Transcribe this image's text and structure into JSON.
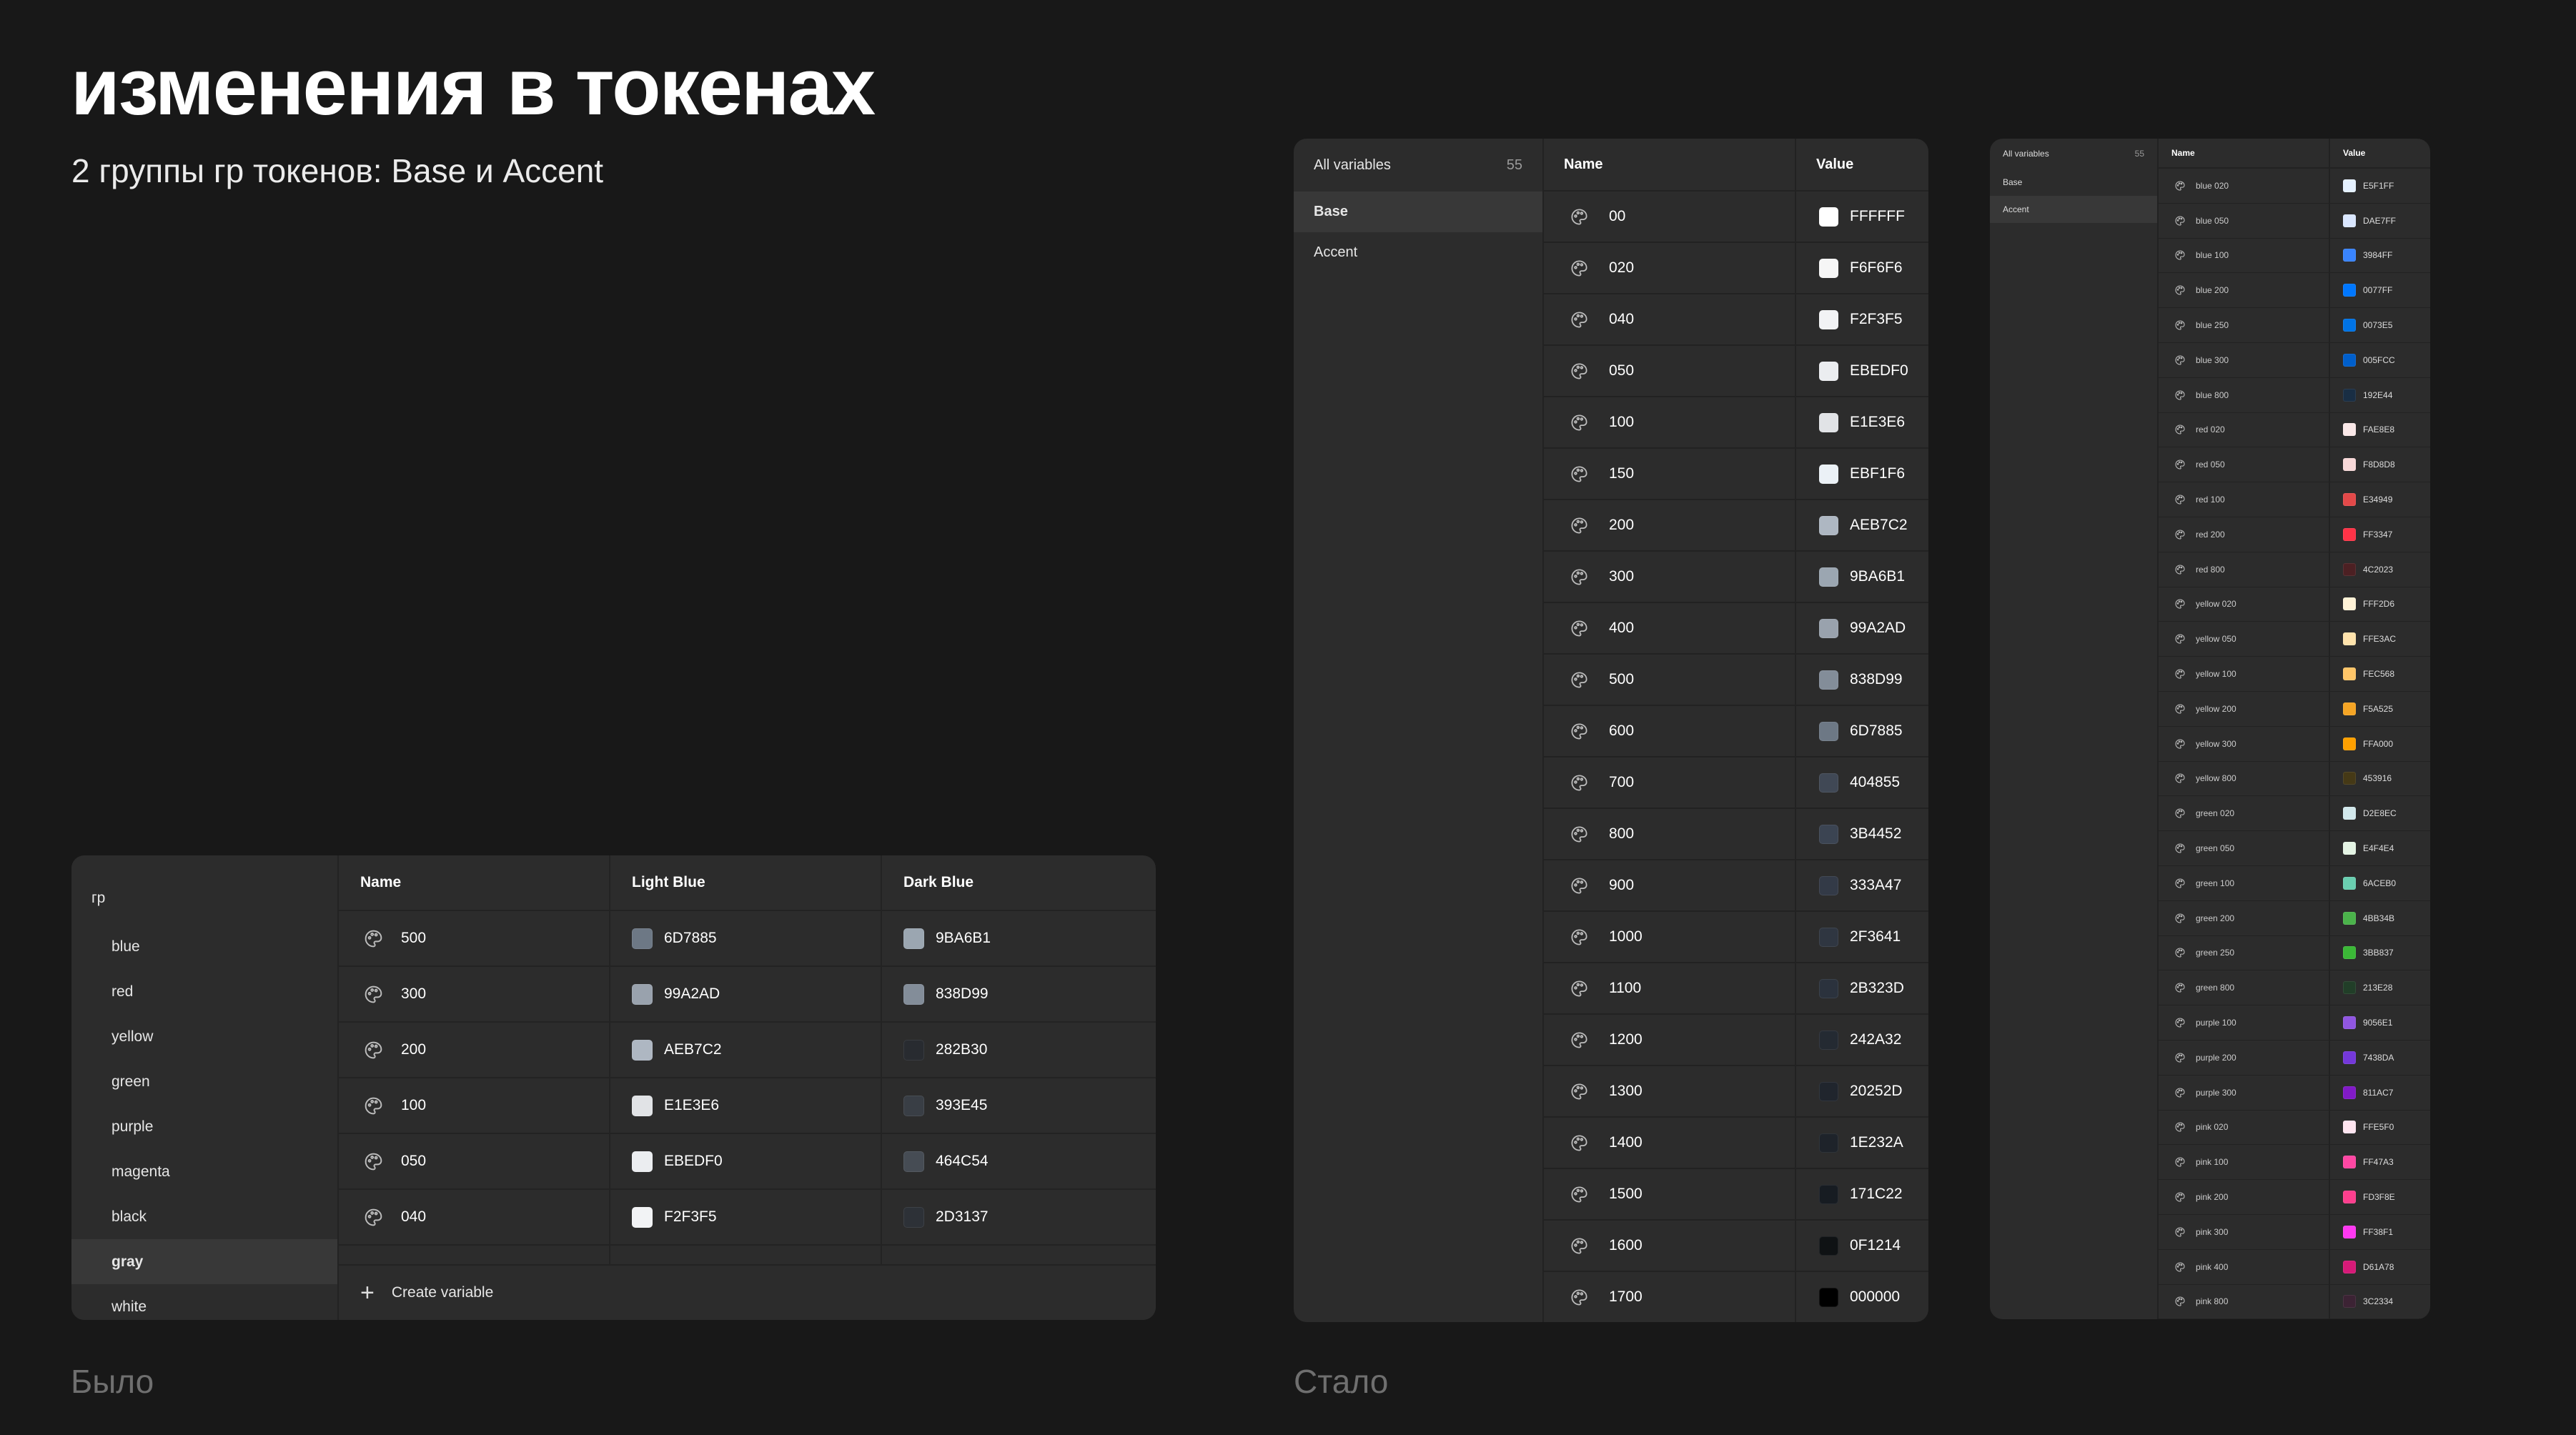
{
  "slide": {
    "title": "изменения в токенах",
    "subtitle": "2 группы гр токенов: Base и Accent",
    "before_caption": "Было",
    "after_caption": "Стало"
  },
  "old_panel": {
    "group": "гр",
    "groups": [
      {
        "label": "blue",
        "active": false
      },
      {
        "label": "red",
        "active": false
      },
      {
        "label": "yellow",
        "active": false
      },
      {
        "label": "green",
        "active": false
      },
      {
        "label": "purple",
        "active": false
      },
      {
        "label": "magenta",
        "active": false
      },
      {
        "label": "black",
        "active": false
      },
      {
        "label": "gray",
        "active": true
      },
      {
        "label": "white",
        "active": false
      }
    ],
    "columns": {
      "name": "Name",
      "light": "Light Blue",
      "dark": "Dark Blue"
    },
    "rows": [
      {
        "name": "500",
        "light": "6D7885",
        "light_color": "#6D7885",
        "dark": "9BA6B1",
        "dark_color": "#9BA6B1"
      },
      {
        "name": "300",
        "light": "99A2AD",
        "light_color": "#99A2AD",
        "dark": "838D99",
        "dark_color": "#838D99"
      },
      {
        "name": "200",
        "light": "AEB7C2",
        "light_color": "#AEB7C2",
        "dark": "282B30",
        "dark_color": "#282B30"
      },
      {
        "name": "100",
        "light": "E1E3E6",
        "light_color": "#E1E3E6",
        "dark": "393E45",
        "dark_color": "#393E45"
      },
      {
        "name": "050",
        "light": "EBEDF0",
        "light_color": "#EBEDF0",
        "dark": "464C54",
        "dark_color": "#464C54"
      },
      {
        "name": "040",
        "light": "F2F3F5",
        "light_color": "#F2F3F5",
        "dark": "2D3137",
        "dark_color": "#2D3137"
      }
    ],
    "create_label": "Create variable"
  },
  "new_panel_base": {
    "sidebar_header": "All variables",
    "count": "55",
    "groups": [
      {
        "label": "Base",
        "active": true
      },
      {
        "label": "Accent",
        "active": false
      }
    ],
    "columns": {
      "name": "Name",
      "value": "Value"
    },
    "rows": [
      {
        "name": "00",
        "value": "FFFFFF",
        "color": "#FFFFFF"
      },
      {
        "name": "020",
        "value": "F6F6F6",
        "color": "#F6F6F6"
      },
      {
        "name": "040",
        "value": "F2F3F5",
        "color": "#F2F3F5"
      },
      {
        "name": "050",
        "value": "EBEDF0",
        "color": "#EBEDF0"
      },
      {
        "name": "100",
        "value": "E1E3E6",
        "color": "#E1E3E6"
      },
      {
        "name": "150",
        "value": "EBF1F6",
        "color": "#EBF1F6"
      },
      {
        "name": "200",
        "value": "AEB7C2",
        "color": "#AEB7C2"
      },
      {
        "name": "300",
        "value": "9BA6B1",
        "color": "#9BA6B1"
      },
      {
        "name": "400",
        "value": "99A2AD",
        "color": "#99A2AD"
      },
      {
        "name": "500",
        "value": "838D99",
        "color": "#838D99"
      },
      {
        "name": "600",
        "value": "6D7885",
        "color": "#6D7885"
      },
      {
        "name": "700",
        "value": "404855",
        "color": "#404855"
      },
      {
        "name": "800",
        "value": "3B4452",
        "color": "#3B4452"
      },
      {
        "name": "900",
        "value": "333A47",
        "color": "#333A47"
      },
      {
        "name": "1000",
        "value": "2F3641",
        "color": "#2F3641"
      },
      {
        "name": "1100",
        "value": "2B323D",
        "color": "#2B323D"
      },
      {
        "name": "1200",
        "value": "242A32",
        "color": "#242A32"
      },
      {
        "name": "1300",
        "value": "20252D",
        "color": "#20252D"
      },
      {
        "name": "1400",
        "value": "1E232A",
        "color": "#1E232A"
      },
      {
        "name": "1500",
        "value": "171C22",
        "color": "#171C22"
      },
      {
        "name": "1600",
        "value": "0F1214",
        "color": "#0F1214"
      },
      {
        "name": "1700",
        "value": "000000",
        "color": "#000000"
      }
    ]
  },
  "new_panel_accent": {
    "sidebar_header": "All variables",
    "count": "55",
    "groups": [
      {
        "label": "Base",
        "active": false
      },
      {
        "label": "Accent",
        "active": true
      }
    ],
    "columns": {
      "name": "Name",
      "value": "Value"
    },
    "rows": [
      {
        "name": "blue 020",
        "value": "E5F1FF",
        "color": "#E5F1FF"
      },
      {
        "name": "blue 050",
        "value": "DAE7FF",
        "color": "#DAE7FF"
      },
      {
        "name": "blue 100",
        "value": "3984FF",
        "color": "#3984FF"
      },
      {
        "name": "blue 200",
        "value": "0077FF",
        "color": "#0077FF"
      },
      {
        "name": "blue 250",
        "value": "0073E5",
        "color": "#0073E5"
      },
      {
        "name": "blue 300",
        "value": "005FCC",
        "color": "#005FCC"
      },
      {
        "name": "blue 800",
        "value": "192E44",
        "color": "#192E44"
      },
      {
        "name": "red 020",
        "value": "FAE8E8",
        "color": "#FAE8E8"
      },
      {
        "name": "red 050",
        "value": "F8D8D8",
        "color": "#F8D8D8"
      },
      {
        "name": "red 100",
        "value": "E34949",
        "color": "#E34949"
      },
      {
        "name": "red 200",
        "value": "FF3347",
        "color": "#FF3347"
      },
      {
        "name": "red 800",
        "value": "4C2023",
        "color": "#4C2023"
      },
      {
        "name": "yellow 020",
        "value": "FFF2D6",
        "color": "#FFF2D6"
      },
      {
        "name": "yellow 050",
        "value": "FFE3AC",
        "color": "#FFE3AC"
      },
      {
        "name": "yellow 100",
        "value": "FEC568",
        "color": "#FEC568"
      },
      {
        "name": "yellow 200",
        "value": "F5A525",
        "color": "#F5A525"
      },
      {
        "name": "yellow 300",
        "value": "FFA000",
        "color": "#FFA000"
      },
      {
        "name": "yellow 800",
        "value": "453916",
        "color": "#453916"
      },
      {
        "name": "green 020",
        "value": "D2E8EC",
        "color": "#D2E8EC"
      },
      {
        "name": "green 050",
        "value": "E4F4E4",
        "color": "#E4F4E4"
      },
      {
        "name": "green 100",
        "value": "6ACEB0",
        "color": "#6ACEB0"
      },
      {
        "name": "green 200",
        "value": "4BB34B",
        "color": "#4BB34B"
      },
      {
        "name": "green 250",
        "value": "3BB837",
        "color": "#3BB837"
      },
      {
        "name": "green 800",
        "value": "213E28",
        "color": "#213E28"
      },
      {
        "name": "purple 100",
        "value": "9056E1",
        "color": "#9056E1"
      },
      {
        "name": "purple 200",
        "value": "7438DA",
        "color": "#7438DA"
      },
      {
        "name": "purple 300",
        "value": "811AC7",
        "color": "#811AC7"
      },
      {
        "name": "pink 020",
        "value": "FFE5F0",
        "color": "#FFE5F0"
      },
      {
        "name": "pink 100",
        "value": "FF47A3",
        "color": "#FF47A3"
      },
      {
        "name": "pink 200",
        "value": "FD3F8E",
        "color": "#FD3F8E"
      },
      {
        "name": "pink 300",
        "value": "FF38F1",
        "color": "#FF38F1"
      },
      {
        "name": "pink 400",
        "value": "D61A78",
        "color": "#D61A78"
      },
      {
        "name": "pink 800",
        "value": "3C2334",
        "color": "#3C2334"
      }
    ]
  }
}
